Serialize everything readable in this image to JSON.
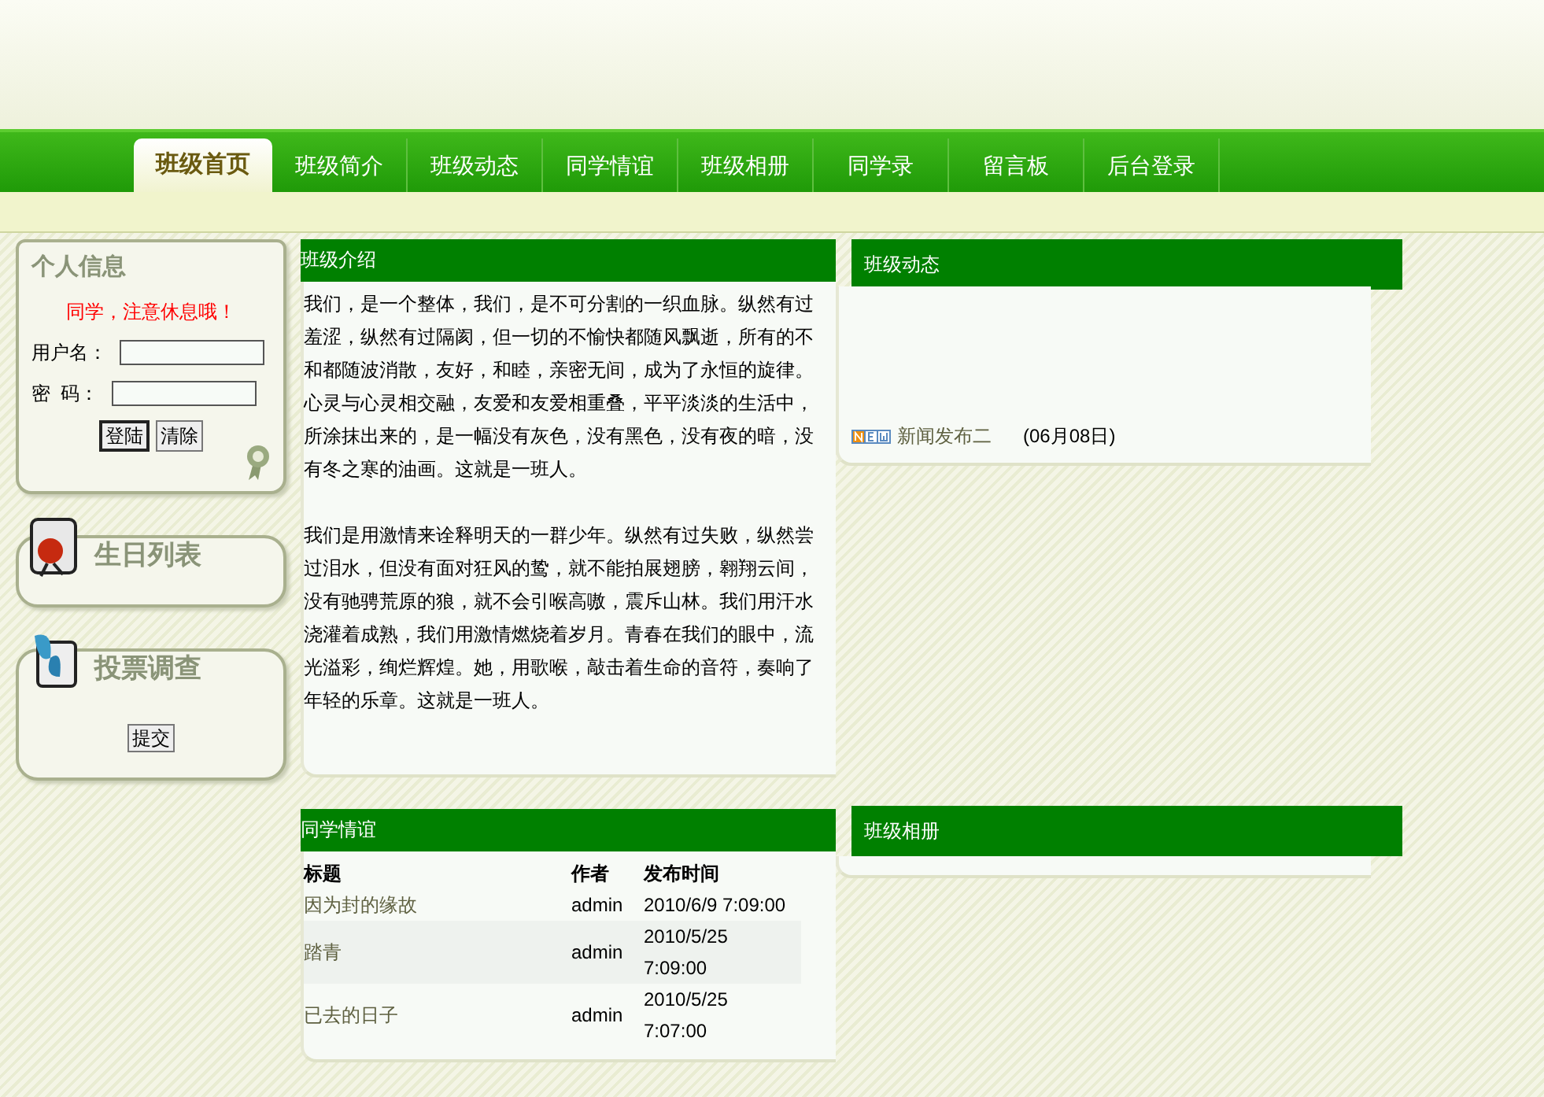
{
  "nav": {
    "tabs": [
      {
        "label": "班级首页",
        "selected": true
      },
      {
        "label": "班级简介",
        "selected": false
      },
      {
        "label": "班级动态",
        "selected": false
      },
      {
        "label": "同学情谊",
        "selected": false
      },
      {
        "label": "班级相册",
        "selected": false
      },
      {
        "label": "同学录",
        "selected": false
      },
      {
        "label": "留言板",
        "selected": false
      },
      {
        "label": "后台登录",
        "selected": false
      }
    ]
  },
  "login_panel": {
    "title": "个人信息",
    "notice": "同学，注意休息哦！",
    "fields": [
      {
        "label": "用户名："
      },
      {
        "label": "密  码："
      }
    ],
    "buttons": [
      "登陆",
      "清除"
    ]
  },
  "birthday_panel": {
    "title": "生日列表"
  },
  "vote_panel": {
    "title": "投票调查",
    "button": "提交"
  },
  "intro": {
    "title": "班级介绍",
    "paragraphs": [
      "我们，是一个整体，我们，是不可分割的一织血脉。纵然有过羞涩，纵然有过隔阂，但一切的不愉快都随风飘逝，所有的不和都随波消散，友好，和睦，亲密无间，成为了永恒的旋律。心灵与心灵相交融，友爱和友爱相重叠，平平淡淡的生活中，所涂抹出来的，是一幅没有灰色，没有黑色，没有夜的暗，没有冬之寒的油画。这就是一班人。",
      "我们是用激情来诠释明天的一群少年。纵然有过失败，纵然尝过泪水，但没有面对狂风的鸷，就不能拍展翅膀，翱翔云间，没有驰骋荒原的狼，就不会引喉高嗷，震斥山林。我们用汗水浇灌着成熟，我们用激情燃烧着岁月。青春在我们的眼中，流光溢彩，绚烂辉煌。她，用歌喉，敲击着生命的音符，奏响了年轻的乐章。这就是一班人。"
    ]
  },
  "news": {
    "title": "班级动态",
    "items": [
      {
        "title": "新闻发布二",
        "date": "(06月08日)"
      }
    ]
  },
  "friendship": {
    "title": "同学情谊",
    "columns": [
      "标题",
      "作者",
      "发布时间"
    ],
    "rows": [
      {
        "cells": [
          "因为封的缘故",
          "admin",
          "2010/6/9 7:09:00"
        ]
      },
      {
        "cells": [
          "踏青",
          "admin",
          "2010/5/25 7:09:00"
        ]
      },
      {
        "cells": [
          "已去的日子",
          "admin",
          "2010/5/25 7:07:00"
        ]
      }
    ]
  },
  "album": {
    "title": "班级相册"
  }
}
